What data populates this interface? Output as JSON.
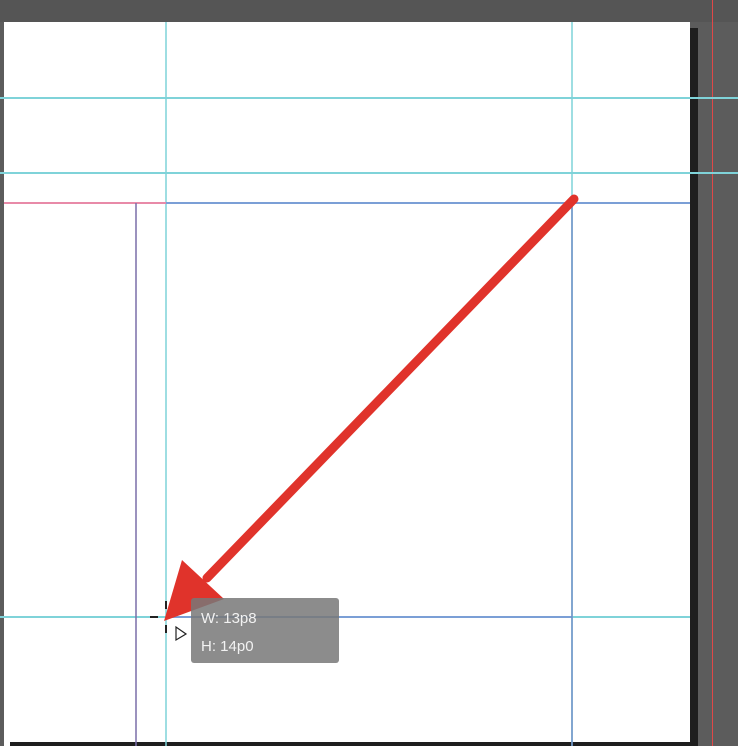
{
  "tooltip": {
    "width_label": "W:",
    "width_value": "13p8",
    "height_label": "H:",
    "height_value": "14p0"
  },
  "colors": {
    "guide_cyan": "#7fd3d9",
    "margin_blue": "#7b9fd6",
    "column_purple": "#7a6fa8",
    "bleed_red": "#e04848",
    "annotation_arrow": "#e0332b"
  },
  "icons": {
    "crosshair": "crosshair-cursor-icon",
    "arrow_cursor": "arrow-cursor-icon",
    "annotation": "red-annotation-arrow"
  }
}
